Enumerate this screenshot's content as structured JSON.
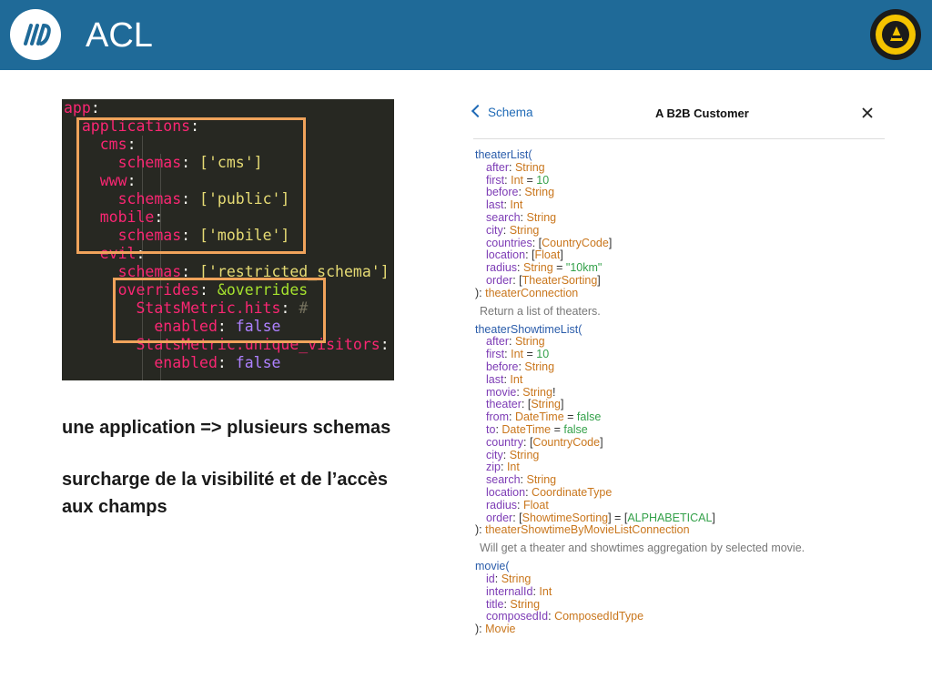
{
  "slide": {
    "title": "ACL",
    "caption_1": "une application => plusieurs schemas",
    "caption_2_line1": "surcharge de la visibilité et de l’accès",
    "caption_2_line2": "aux champs"
  },
  "code_panel": {
    "lines": [
      [
        {
          "t": "app",
          "c": "k"
        },
        {
          "t": ":",
          "c": "p"
        }
      ],
      [
        {
          "t": "  "
        },
        {
          "t": "applications",
          "c": "k"
        },
        {
          "t": ":",
          "c": "p"
        }
      ],
      [
        {
          "t": "    "
        },
        {
          "t": "cms",
          "c": "k"
        },
        {
          "t": ":",
          "c": "p"
        }
      ],
      [
        {
          "t": "      "
        },
        {
          "t": "schemas",
          "c": "k"
        },
        {
          "t": ": ",
          "c": "p"
        },
        {
          "t": "['cms']",
          "c": "s"
        }
      ],
      [
        {
          "t": "    "
        },
        {
          "t": "www",
          "c": "k"
        },
        {
          "t": ":",
          "c": "p"
        }
      ],
      [
        {
          "t": "      "
        },
        {
          "t": "schemas",
          "c": "k"
        },
        {
          "t": ": ",
          "c": "p"
        },
        {
          "t": "['public']",
          "c": "s"
        }
      ],
      [
        {
          "t": "    "
        },
        {
          "t": "mobile",
          "c": "k"
        },
        {
          "t": ":",
          "c": "p"
        }
      ],
      [
        {
          "t": "      "
        },
        {
          "t": "schemas",
          "c": "k"
        },
        {
          "t": ": ",
          "c": "p"
        },
        {
          "t": "['mobile']",
          "c": "s"
        }
      ],
      [
        {
          "t": "    "
        },
        {
          "t": "evil",
          "c": "k"
        },
        {
          "t": ":",
          "c": "p"
        }
      ],
      [
        {
          "t": "      "
        },
        {
          "t": "schemas",
          "c": "k"
        },
        {
          "t": ": ",
          "c": "p"
        },
        {
          "t": "['restricted_schema']",
          "c": "s"
        }
      ],
      [
        {
          "t": "      "
        },
        {
          "t": "overrides",
          "c": "k"
        },
        {
          "t": ": ",
          "c": "p"
        },
        {
          "t": "&overrides",
          "c": "a"
        }
      ],
      [
        {
          "t": "        "
        },
        {
          "t": "StatsMetric.hits",
          "c": "k"
        },
        {
          "t": ": ",
          "c": "p"
        },
        {
          "t": "#",
          "c": "c"
        }
      ],
      [
        {
          "t": "          "
        },
        {
          "t": "enabled",
          "c": "k"
        },
        {
          "t": ": ",
          "c": "p"
        },
        {
          "t": "false",
          "c": "n"
        }
      ],
      [
        {
          "t": "        "
        },
        {
          "t": "StatsMetric.unique_visitors",
          "c": "k"
        },
        {
          "t": ":",
          "c": "p"
        }
      ],
      [
        {
          "t": "          "
        },
        {
          "t": "enabled",
          "c": "k"
        },
        {
          "t": ": ",
          "c": "p"
        },
        {
          "t": "false",
          "c": "n"
        }
      ]
    ]
  },
  "schema_panel": {
    "back_label": "Schema",
    "title": "A B2B Customer",
    "lines": [
      {
        "ind": 0,
        "parts": [
          {
            "t": "theaterList(",
            "c": "fn"
          }
        ]
      },
      {
        "ind": 1,
        "parts": [
          {
            "t": "after",
            "c": "arg"
          },
          {
            "t": ": "
          },
          {
            "t": "String",
            "c": "ty"
          }
        ]
      },
      {
        "ind": 1,
        "parts": [
          {
            "t": "first",
            "c": "arg"
          },
          {
            "t": ": "
          },
          {
            "t": "Int",
            "c": "ty"
          },
          {
            "t": " = "
          },
          {
            "t": "10",
            "c": "df"
          }
        ]
      },
      {
        "ind": 1,
        "parts": [
          {
            "t": "before",
            "c": "arg"
          },
          {
            "t": ": "
          },
          {
            "t": "String",
            "c": "ty"
          }
        ]
      },
      {
        "ind": 1,
        "parts": [
          {
            "t": "last",
            "c": "arg"
          },
          {
            "t": ": "
          },
          {
            "t": "Int",
            "c": "ty"
          }
        ]
      },
      {
        "ind": 1,
        "parts": [
          {
            "t": "search",
            "c": "arg"
          },
          {
            "t": ": "
          },
          {
            "t": "String",
            "c": "ty"
          }
        ]
      },
      {
        "ind": 1,
        "parts": [
          {
            "t": "city",
            "c": "arg"
          },
          {
            "t": ": "
          },
          {
            "t": "String",
            "c": "ty"
          }
        ]
      },
      {
        "ind": 1,
        "parts": [
          {
            "t": "countries",
            "c": "arg"
          },
          {
            "t": ": ["
          },
          {
            "t": "CountryCode",
            "c": "ty"
          },
          {
            "t": "]"
          }
        ]
      },
      {
        "ind": 1,
        "parts": [
          {
            "t": "location",
            "c": "arg"
          },
          {
            "t": ": ["
          },
          {
            "t": "Float",
            "c": "ty"
          },
          {
            "t": "]"
          }
        ]
      },
      {
        "ind": 1,
        "parts": [
          {
            "t": "radius",
            "c": "arg"
          },
          {
            "t": ": "
          },
          {
            "t": "String",
            "c": "ty"
          },
          {
            "t": " = "
          },
          {
            "t": "\"10km\"",
            "c": "df"
          }
        ]
      },
      {
        "ind": 1,
        "parts": [
          {
            "t": "order",
            "c": "arg"
          },
          {
            "t": ": ["
          },
          {
            "t": "TheaterSorting",
            "c": "ty"
          },
          {
            "t": "]"
          }
        ]
      },
      {
        "ind": 0,
        "parts": [
          {
            "t": "): "
          },
          {
            "t": "theaterConnection",
            "c": "ty"
          }
        ]
      },
      {
        "gap": true
      },
      {
        "desc": true,
        "parts": [
          {
            "t": "Return a list of theaters."
          }
        ]
      },
      {
        "gap": true
      },
      {
        "ind": 0,
        "parts": [
          {
            "t": "theaterShowtimeList(",
            "c": "fn"
          }
        ]
      },
      {
        "ind": 1,
        "parts": [
          {
            "t": "after",
            "c": "arg"
          },
          {
            "t": ": "
          },
          {
            "t": "String",
            "c": "ty"
          }
        ]
      },
      {
        "ind": 1,
        "parts": [
          {
            "t": "first",
            "c": "arg"
          },
          {
            "t": ": "
          },
          {
            "t": "Int",
            "c": "ty"
          },
          {
            "t": " = "
          },
          {
            "t": "10",
            "c": "df"
          }
        ]
      },
      {
        "ind": 1,
        "parts": [
          {
            "t": "before",
            "c": "arg"
          },
          {
            "t": ": "
          },
          {
            "t": "String",
            "c": "ty"
          }
        ]
      },
      {
        "ind": 1,
        "parts": [
          {
            "t": "last",
            "c": "arg"
          },
          {
            "t": ": "
          },
          {
            "t": "Int",
            "c": "ty"
          }
        ]
      },
      {
        "ind": 1,
        "parts": [
          {
            "t": "movie",
            "c": "arg"
          },
          {
            "t": ": "
          },
          {
            "t": "String",
            "c": "ty"
          },
          {
            "t": "!"
          }
        ]
      },
      {
        "ind": 1,
        "parts": [
          {
            "t": "theater",
            "c": "arg"
          },
          {
            "t": ": ["
          },
          {
            "t": "String",
            "c": "ty"
          },
          {
            "t": "]"
          }
        ]
      },
      {
        "ind": 1,
        "parts": [
          {
            "t": "from",
            "c": "arg"
          },
          {
            "t": ": "
          },
          {
            "t": "DateTime",
            "c": "ty"
          },
          {
            "t": " = "
          },
          {
            "t": "false",
            "c": "df"
          }
        ]
      },
      {
        "ind": 1,
        "parts": [
          {
            "t": "to",
            "c": "arg"
          },
          {
            "t": ": "
          },
          {
            "t": "DateTime",
            "c": "ty"
          },
          {
            "t": " = "
          },
          {
            "t": "false",
            "c": "df"
          }
        ]
      },
      {
        "ind": 1,
        "parts": [
          {
            "t": "country",
            "c": "arg"
          },
          {
            "t": ": ["
          },
          {
            "t": "CountryCode",
            "c": "ty"
          },
          {
            "t": "]"
          }
        ]
      },
      {
        "ind": 1,
        "parts": [
          {
            "t": "city",
            "c": "arg"
          },
          {
            "t": ": "
          },
          {
            "t": "String",
            "c": "ty"
          }
        ]
      },
      {
        "ind": 1,
        "parts": [
          {
            "t": "zip",
            "c": "arg"
          },
          {
            "t": ": "
          },
          {
            "t": "Int",
            "c": "ty"
          }
        ]
      },
      {
        "ind": 1,
        "parts": [
          {
            "t": "search",
            "c": "arg"
          },
          {
            "t": ": "
          },
          {
            "t": "String",
            "c": "ty"
          }
        ]
      },
      {
        "ind": 1,
        "parts": [
          {
            "t": "location",
            "c": "arg"
          },
          {
            "t": ": "
          },
          {
            "t": "CoordinateType",
            "c": "ty"
          }
        ]
      },
      {
        "ind": 1,
        "parts": [
          {
            "t": "radius",
            "c": "arg"
          },
          {
            "t": ": "
          },
          {
            "t": "Float",
            "c": "ty"
          }
        ]
      },
      {
        "ind": 1,
        "parts": [
          {
            "t": "order",
            "c": "arg"
          },
          {
            "t": ": ["
          },
          {
            "t": "ShowtimeSorting",
            "c": "ty"
          },
          {
            "t": "] = ["
          },
          {
            "t": "ALPHABETICAL",
            "c": "df"
          },
          {
            "t": "]"
          }
        ]
      },
      {
        "ind": 0,
        "parts": [
          {
            "t": "): "
          },
          {
            "t": "theaterShowtimeByMovieListConnection",
            "c": "ty"
          }
        ]
      },
      {
        "gap": true
      },
      {
        "desc": true,
        "parts": [
          {
            "t": "Will get a theater and showtimes aggregation by selected movie."
          }
        ]
      },
      {
        "gap": true
      },
      {
        "ind": 0,
        "parts": [
          {
            "t": "movie(",
            "c": "fn"
          }
        ]
      },
      {
        "ind": 1,
        "parts": [
          {
            "t": "id",
            "c": "arg"
          },
          {
            "t": ": "
          },
          {
            "t": "String",
            "c": "ty"
          }
        ]
      },
      {
        "ind": 1,
        "parts": [
          {
            "t": "internalId",
            "c": "arg"
          },
          {
            "t": ": "
          },
          {
            "t": "Int",
            "c": "ty"
          }
        ]
      },
      {
        "ind": 1,
        "parts": [
          {
            "t": "title",
            "c": "arg"
          },
          {
            "t": ": "
          },
          {
            "t": "String",
            "c": "ty"
          }
        ]
      },
      {
        "ind": 1,
        "parts": [
          {
            "t": "composedId",
            "c": "arg"
          },
          {
            "t": ": "
          },
          {
            "t": "ComposedIdType",
            "c": "ty"
          }
        ]
      },
      {
        "ind": 0,
        "parts": [
          {
            "t": "): "
          },
          {
            "t": "Movie",
            "c": "ty"
          }
        ]
      }
    ]
  },
  "colors": {
    "header_bg": "#1f6a98",
    "code_bg": "#272822",
    "highlight_box": "#f0a35b",
    "link_blue": "#1f6ab6"
  }
}
